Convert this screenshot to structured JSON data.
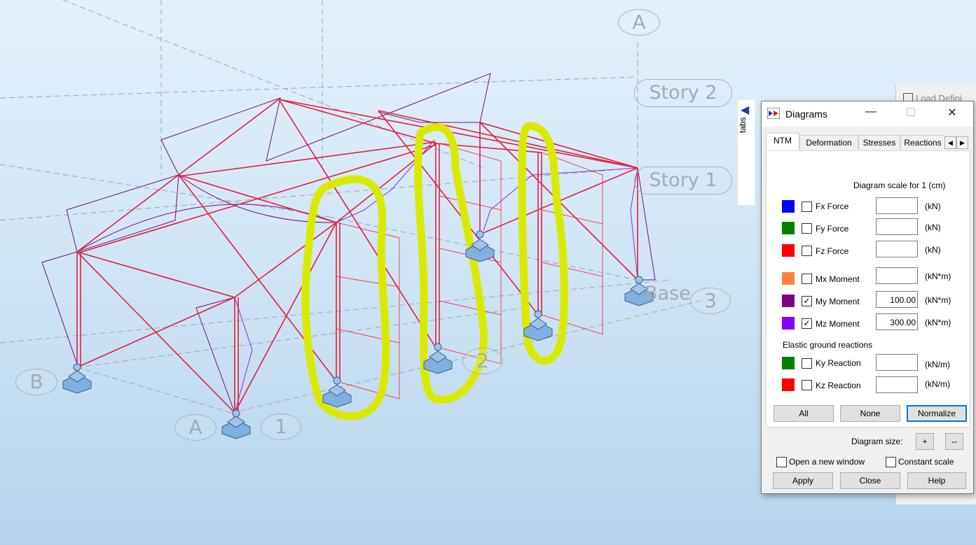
{
  "viewport": {
    "grid_labels": {
      "axis_a_top": "A",
      "axis_b": "B",
      "axis_a_bottom": "A",
      "axis_1": "1",
      "axis_2": "2",
      "axis_3": "3"
    },
    "story_labels": {
      "story2": "Story 2",
      "story1": "Story 1",
      "base": "Base"
    },
    "annotation_color": "#d9ea00",
    "structure_color": "#e0203c",
    "moment_my_color": "#7a0f78",
    "moment_mz_color": "#8a2be2",
    "support_color": "#7fb0e0"
  },
  "side_panel": {
    "tabs_label": "tabs",
    "load_def_title": "Load Defini"
  },
  "dialog": {
    "title": "Diagrams",
    "tabs": [
      "NTM",
      "Deformation",
      "Stresses",
      "Reactions"
    ],
    "active_tab": "NTM",
    "scale_label": "Diagram scale for 1  (cm)",
    "rows": [
      {
        "label": "Fx Force",
        "color": "#0000ff",
        "checked": false,
        "value": "",
        "unit": "(kN)"
      },
      {
        "label": "Fy Force",
        "color": "#008000",
        "checked": false,
        "value": "",
        "unit": "(kN)"
      },
      {
        "label": "Fz Force",
        "color": "#ff0000",
        "checked": false,
        "value": "",
        "unit": "(kN)"
      },
      {
        "label": "Mx Moment",
        "color": "#ff8040",
        "checked": false,
        "value": "",
        "unit": "(kN*m)"
      },
      {
        "label": "My Moment",
        "color": "#800080",
        "checked": true,
        "value": "100.00",
        "unit": "(kN*m)"
      },
      {
        "label": "Mz Moment",
        "color": "#8000ff",
        "checked": true,
        "value": "300.00",
        "unit": "(kN*m)"
      }
    ],
    "elastic_label": "Elastic ground reactions",
    "elastic_rows": [
      {
        "label": "Ky Reaction",
        "color": "#008000",
        "checked": false,
        "value": "",
        "unit": "(kN/m)"
      },
      {
        "label": "Kz Reaction",
        "color": "#ff0000",
        "checked": false,
        "value": "",
        "unit": "(kN/m)"
      }
    ],
    "buttons": {
      "all": "All",
      "none": "None",
      "normalize": "Normalize",
      "diagram_size": "Diagram size:",
      "plus": "+",
      "minus": "--",
      "open_new_window": "Open a new window",
      "constant_scale": "Constant scale",
      "apply": "Apply",
      "close": "Close",
      "help": "Help"
    }
  }
}
